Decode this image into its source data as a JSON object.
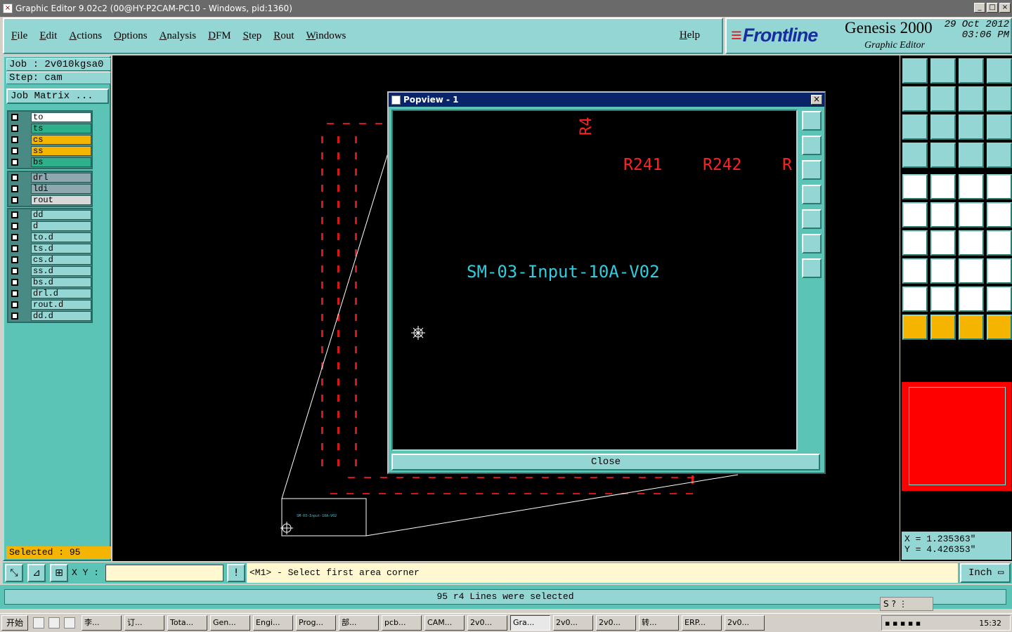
{
  "window": {
    "title": "Graphic Editor 9.02c2 (00@HY-P2CAM-PC10 - Windows, pid:1360)"
  },
  "menu": [
    "File",
    "Edit",
    "Actions",
    "Options",
    "Analysis",
    "DFM",
    "Step",
    "Rout",
    "Windows"
  ],
  "help_label": "Help",
  "brand": {
    "logo": "Frontline",
    "product": "Genesis 2000",
    "subtitle": "Graphic Editor",
    "date": "29 Oct 2012",
    "time": "03:06 PM"
  },
  "job": {
    "job_label": "Job : 2v010kgsa0",
    "step_label": "Step: cam",
    "matrix_button": "Job Matrix ..."
  },
  "layers": {
    "group1": [
      {
        "name": "to",
        "color": "#ffffff"
      },
      {
        "name": "ts",
        "color": "#2eb08a"
      },
      {
        "name": "cs",
        "color": "#f5b400"
      },
      {
        "name": "ss",
        "color": "#f5b400"
      },
      {
        "name": "bs",
        "color": "#2eb08a"
      }
    ],
    "group2": [
      {
        "name": "drl",
        "color": "#8fa8b0"
      },
      {
        "name": "ldi",
        "color": "#8fa8b0"
      },
      {
        "name": "rout",
        "color": "#d8d8d8"
      }
    ],
    "group3": [
      {
        "name": "dd",
        "color": "#93d6d3"
      },
      {
        "name": "d",
        "color": "#93d6d3"
      },
      {
        "name": "to.d",
        "color": "#93d6d3"
      },
      {
        "name": "ts.d",
        "color": "#93d6d3"
      },
      {
        "name": "cs.d",
        "color": "#93d6d3"
      },
      {
        "name": "ss.d",
        "color": "#93d6d3"
      },
      {
        "name": "bs.d",
        "color": "#93d6d3"
      },
      {
        "name": "drl.d",
        "color": "#93d6d3"
      },
      {
        "name": "rout.d",
        "color": "#93d6d3"
      },
      {
        "name": "dd.d",
        "color": "#93d6d3"
      }
    ]
  },
  "selected_label": "Selected : 95",
  "popview": {
    "title": "Popview - 1",
    "labels": {
      "r4": "R4",
      "r241": "R241",
      "r242": "R242",
      "r": "R"
    },
    "board_name": "SM-03-Input-10A-V02",
    "close_label": "Close"
  },
  "canvas": {
    "board_small_label": "SM-03-Input-10A-V02"
  },
  "coords": {
    "x": "X = 1.235363\"",
    "y": "Y = 4.426353\""
  },
  "command": {
    "xy_label": "X Y :",
    "prompt": "<M1> - Select first area corner",
    "unit": "Inch"
  },
  "status": {
    "message": "95 r4 Lines were selected"
  },
  "taskbar": {
    "start": "开始",
    "tasks": [
      "李...",
      "订...",
      "Tota...",
      "Gen...",
      "Engi...",
      "Prog...",
      "部...",
      "pcb...",
      "CAM...",
      "2v0...",
      "Gra...",
      "2v0...",
      "2v0...",
      "转...",
      "ERP...",
      "2v0..."
    ],
    "active_index": 10,
    "clock": "15:32"
  },
  "colors": {
    "accent_teal": "#5bc4b6",
    "light_teal": "#93d6d3",
    "canvas": "#000000",
    "feature_red": "#ff1a1a",
    "text_cyan": "#33ccdd"
  }
}
